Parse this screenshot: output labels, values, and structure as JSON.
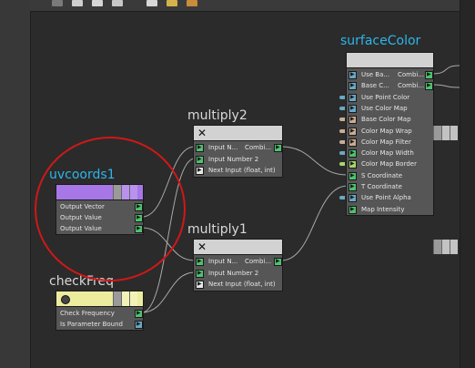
{
  "colors": {
    "canvas": "#2b2b2b",
    "selected_title": "#2cb6ea",
    "annotation": "#d01818",
    "port_green": "#4fc26f",
    "port_blue": "#6aa8c6",
    "port_white": "#e8e8e8",
    "header_gray": "#d2d2d2",
    "header_purple": "#a777e8",
    "header_yellow": "#ecec9e"
  },
  "toolbar": {
    "icons": [
      "display-icon",
      "grid-icon",
      "layout-icon",
      "panel-icon",
      "page-icon",
      "folder-icon",
      "box-icon"
    ]
  },
  "nodes": [
    {
      "id": "surfaceColor",
      "title": "surfaceColor",
      "selected": true,
      "header_icon": "",
      "header_color": "#d2d2d2",
      "rows": [
        {
          "label": "Use Ba...",
          "label2": "Combi...",
          "in": "port_blue",
          "out": "port_green",
          "bulb": ""
        },
        {
          "label": "Base C...",
          "label2": "Combi...",
          "in": "port_blue",
          "out": "port_green",
          "bulb": ""
        },
        {
          "label": "Use Point Color",
          "label2": "",
          "in": "port_blue",
          "out": "",
          "bulb": "#6aa8c6"
        },
        {
          "label": "Use Color Map",
          "label2": "",
          "in": "port_blue",
          "out": "",
          "bulb": "#6aa8c6"
        },
        {
          "label": "Base Color Map",
          "label2": "",
          "in": "port_tan",
          "out": "",
          "bulb": "#c9ad93"
        },
        {
          "label": "Color Map Wrap",
          "label2": "",
          "in": "port_tan",
          "out": "",
          "bulb": "#c9ad93"
        },
        {
          "label": "Color Map Filter",
          "label2": "",
          "in": "port_tan",
          "out": "",
          "bulb": "#c9ad93"
        },
        {
          "label": "Color Map Width",
          "label2": "",
          "in": "port_green",
          "out": "",
          "bulb": "#6aa8c6"
        },
        {
          "label": "Color Map Border",
          "label2": "",
          "in": "port_lime",
          "out": "",
          "bulb": "#a6d86a"
        },
        {
          "label": "S Coordinate",
          "label2": "",
          "in": "port_green",
          "out": "",
          "bulb": ""
        },
        {
          "label": "T Coordinate",
          "label2": "",
          "in": "port_green",
          "out": "",
          "bulb": ""
        },
        {
          "label": "Use Point Alpha",
          "label2": "",
          "in": "port_blue",
          "out": "",
          "bulb": "#6aa8c6"
        },
        {
          "label": "Map Intensity",
          "label2": "",
          "in": "port_green",
          "out": "",
          "bulb": ""
        }
      ]
    },
    {
      "id": "multiply2",
      "title": "multiply2",
      "selected": false,
      "header_icon": "✕",
      "header_color": "#d2d2d2",
      "rows": [
        {
          "label": "Input N...",
          "label2": "Combi...",
          "in": "port_green",
          "out": "port_green",
          "bulb": ""
        },
        {
          "label": "Input Number 2",
          "label2": "",
          "in": "port_green",
          "out": "",
          "bulb": ""
        },
        {
          "label": "Next Input (float, int)",
          "label2": "",
          "in": "port_white",
          "out": "",
          "bulb": ""
        }
      ]
    },
    {
      "id": "multiply1",
      "title": "multiply1",
      "selected": false,
      "header_icon": "✕",
      "header_color": "#d2d2d2",
      "rows": [
        {
          "label": "Input N...",
          "label2": "Combi...",
          "in": "port_green",
          "out": "port_green",
          "bulb": ""
        },
        {
          "label": "Input Number 2",
          "label2": "",
          "in": "port_green",
          "out": "",
          "bulb": ""
        },
        {
          "label": "Next Input (float, int)",
          "label2": "",
          "in": "port_white",
          "out": "",
          "bulb": ""
        }
      ]
    },
    {
      "id": "uvcoords1",
      "title": "uvcoords1",
      "selected": true,
      "header_icon": "",
      "header_color": "#a777e8",
      "rows": [
        {
          "label": "Output Vector",
          "label2": "",
          "in": "",
          "out": "port_green",
          "bulb": ""
        },
        {
          "label": "Output Value",
          "label2": "",
          "in": "",
          "out": "port_green",
          "bulb": ""
        },
        {
          "label": "Output Value",
          "label2": "",
          "in": "",
          "out": "port_green",
          "bulb": ""
        }
      ]
    },
    {
      "id": "checkFreq",
      "title": "checkFreq",
      "selected": false,
      "header_icon": "●",
      "header_color": "#ecec9e",
      "rows": [
        {
          "label": "Check Frequency",
          "label2": "",
          "in": "",
          "out": "port_green",
          "bulb": ""
        },
        {
          "label": "Is Parameter Bound",
          "label2": "",
          "in": "",
          "out": "port_blue",
          "bulb": ""
        }
      ]
    }
  ]
}
